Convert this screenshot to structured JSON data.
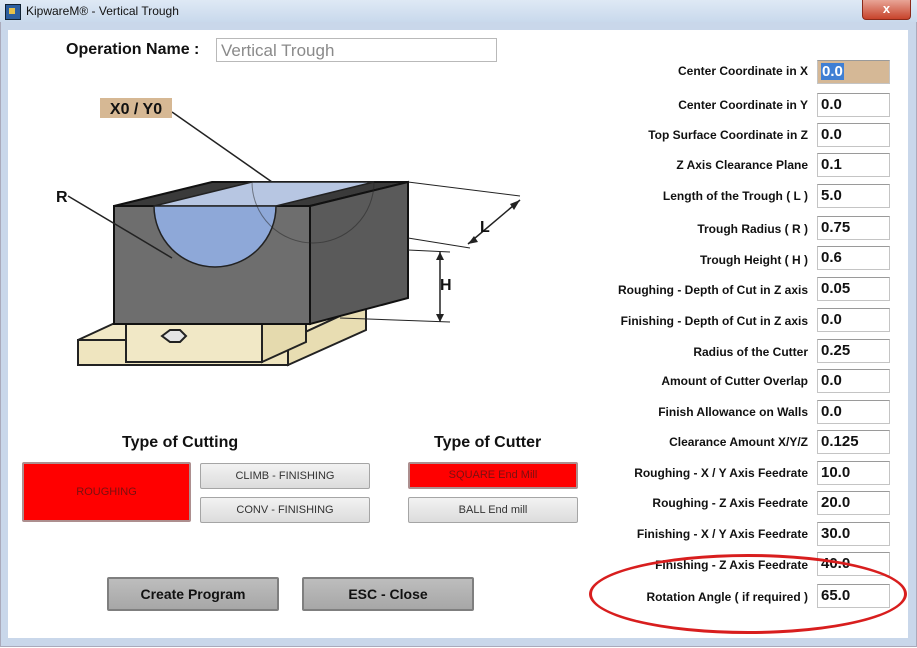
{
  "window": {
    "title": "KipwareM® - Vertical Trough",
    "close_symbol": "x",
    "icon": "app-icon"
  },
  "operation": {
    "label": "Operation Name :",
    "value": "Vertical Trough"
  },
  "fields": [
    {
      "label": "Center Coordinate in X",
      "value": "0.0"
    },
    {
      "label": "Center Coordinate in Y",
      "value": "0.0"
    },
    {
      "label": "Top Surface Coordinate in Z",
      "value": "0.0"
    },
    {
      "label": "Z Axis Clearance Plane",
      "value": "0.1"
    },
    {
      "label": "Length of the Trough ( L )",
      "value": "5.0"
    },
    {
      "label": "Trough Radius ( R )",
      "value": "0.75"
    },
    {
      "label": "Trough Height ( H )",
      "value": "0.6"
    },
    {
      "label": "Roughing - Depth of Cut in Z axis",
      "value": "0.05"
    },
    {
      "label": "Finishing - Depth of Cut in Z axis",
      "value": "0.0"
    },
    {
      "label": "Radius of the Cutter",
      "value": "0.25"
    },
    {
      "label": "Amount of Cutter Overlap",
      "value": "0.0"
    },
    {
      "label": "Finish Allowance on Walls",
      "value": "0.0"
    },
    {
      "label": "Clearance Amount X/Y/Z",
      "value": "0.125"
    },
    {
      "label": "Roughing - X / Y Axis Feedrate",
      "value": "10.0"
    },
    {
      "label": "Roughing - Z Axis Feedrate",
      "value": "20.0"
    },
    {
      "label": "Finishing - X / Y Axis Feedrate",
      "value": "30.0"
    },
    {
      "label": "Finishing - Z Axis Feedrate",
      "value": "40.0"
    },
    {
      "label": "Rotation Angle ( if required )",
      "value": "65.0"
    }
  ],
  "diagram": {
    "origin_label": "X0 / Y0",
    "radius_label": "R",
    "length_label": "L",
    "height_label": "H"
  },
  "cutting": {
    "title": "Type of Cutting",
    "roughing": "ROUGHING",
    "climb": "CLIMB - FINISHING",
    "conv": "CONV - FINISHING"
  },
  "cutter": {
    "title": "Type of Cutter",
    "square": "SQUARE End Mill",
    "ball": "BALL End mill"
  },
  "actions": {
    "create": "Create Program",
    "close": "ESC - Close"
  },
  "colors": {
    "selected": "#ff0000",
    "highlight_oval": "#d81e1e",
    "active_field": "#d5b896"
  }
}
